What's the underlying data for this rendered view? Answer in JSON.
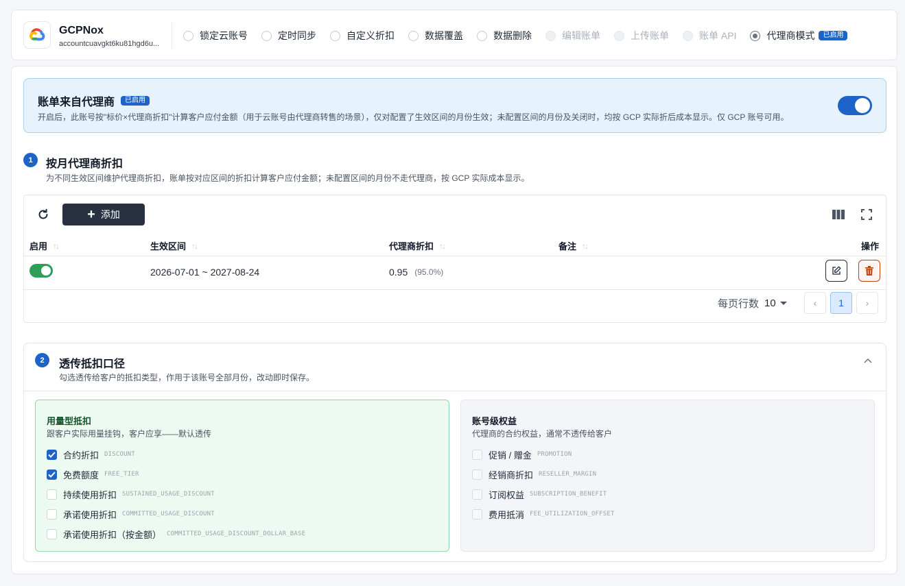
{
  "header": {
    "account_name": "GCPNox",
    "account_id": "accountcuavgkt6ku81hgd6u...",
    "modes": [
      {
        "label": "锁定云账号",
        "state": "normal"
      },
      {
        "label": "定时同步",
        "state": "normal"
      },
      {
        "label": "自定义折扣",
        "state": "normal"
      },
      {
        "label": "数据覆盖",
        "state": "normal"
      },
      {
        "label": "数据删除",
        "state": "normal"
      },
      {
        "label": "编辑账单",
        "state": "disabled"
      },
      {
        "label": "上传账单",
        "state": "disabled"
      },
      {
        "label": "账单 API",
        "state": "disabled"
      },
      {
        "label": "代理商模式",
        "state": "selected",
        "badge": "已启用"
      }
    ]
  },
  "banner": {
    "title": "账单来自代理商",
    "badge": "已启用",
    "desc": "开启后，此账号按\"标价×代理商折扣\"计算客户应付金额（用于云账号由代理商转售的场景），仅对配置了生效区间的月份生效；未配置区间的月份及关闭时，均按 GCP 实际折后成本显示。仅 GCP 账号可用。",
    "enabled": true
  },
  "section1": {
    "num": "1",
    "title": "按月代理商折扣",
    "desc": "为不同生效区间维护代理商折扣，账单按对应区间的折扣计算客户应付金额；未配置区间的月份不走代理商，按 GCP 实际成本显示。",
    "add_label": "添加",
    "columns": {
      "enabled": "启用",
      "period": "生效区间",
      "discount": "代理商折扣",
      "note": "备注",
      "ops": "操作"
    },
    "rows": [
      {
        "enabled": true,
        "period": "2026-07-01 ~ 2027-08-24",
        "discount": "0.95",
        "discount_pct": "(95.0%)",
        "note": ""
      }
    ],
    "pager": {
      "rows_label": "每页行数",
      "rows_value": "10",
      "current_page": "1",
      "prev": "‹",
      "next": "›"
    }
  },
  "section2": {
    "num": "2",
    "title": "透传抵扣口径",
    "desc": "勾选透传给客户的抵扣类型，作用于该账号全部月份，改动即时保存。",
    "usage_group": {
      "title": "用量型抵扣",
      "desc": "跟客户实际用量挂钩，客户应享——默认透传",
      "options": [
        {
          "label": "合约折扣",
          "code": "DISCOUNT",
          "checked": true
        },
        {
          "label": "免费额度",
          "code": "FREE_TIER",
          "checked": true
        },
        {
          "label": "持续使用折扣",
          "code": "SUSTAINED_USAGE_DISCOUNT",
          "checked": false
        },
        {
          "label": "承诺使用折扣",
          "code": "COMMITTED_USAGE_DISCOUNT",
          "checked": false
        },
        {
          "label": "承诺使用折扣（按金额）",
          "code": "COMMITTED_USAGE_DISCOUNT_DOLLAR_BASE",
          "checked": false
        }
      ]
    },
    "account_group": {
      "title": "账号级权益",
      "desc": "代理商的合约权益，通常不透传给客户",
      "options": [
        {
          "label": "促销 / 赠金",
          "code": "PROMOTION",
          "checked": false
        },
        {
          "label": "经销商折扣",
          "code": "RESELLER_MARGIN",
          "checked": false
        },
        {
          "label": "订阅权益",
          "code": "SUBSCRIPTION_BENEFIT",
          "checked": false
        },
        {
          "label": "费用抵消",
          "code": "FEE_UTILIZATION_OFFSET",
          "checked": false
        }
      ]
    }
  },
  "colors": {
    "accent": "#1e63c7",
    "success": "#2f9e57",
    "danger": "#c2410c",
    "dark_button": "#273142"
  }
}
